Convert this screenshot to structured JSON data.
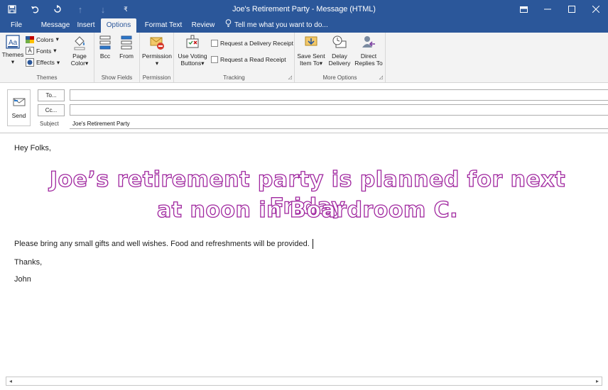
{
  "window": {
    "title": "Joe's Retirement Party - Message (HTML)",
    "accent": "#2b579a"
  },
  "quick_access": {
    "save_icon": "save-icon",
    "undo_icon": "undo-icon",
    "redo_icon": "redo-icon",
    "up_icon": "up-arrow-icon",
    "down_icon": "down-arrow-icon",
    "customize_icon": "customize-icon"
  },
  "tabs": [
    {
      "label": "File"
    },
    {
      "label": "Message"
    },
    {
      "label": "Insert"
    },
    {
      "label": "Options"
    },
    {
      "label": "Format Text"
    },
    {
      "label": "Review"
    }
  ],
  "tell_me": {
    "label": "Tell me what you want to do..."
  },
  "ribbon": {
    "themes_group": {
      "themes": "Themes",
      "colors": "Colors",
      "fonts": "Fonts",
      "effects": "Effects",
      "page_color_1": "Page",
      "page_color_2": "Color",
      "label": "Themes"
    },
    "show_fields": {
      "bcc": "Bcc",
      "from": "From",
      "label": "Show Fields"
    },
    "permission": {
      "button": "Permission",
      "label": "Permission"
    },
    "tracking": {
      "voting_1": "Use Voting",
      "voting_2": "Buttons",
      "delivery": "Request a Delivery Receipt",
      "read": "Request a Read Receipt",
      "label": "Tracking"
    },
    "more_options": {
      "save_sent_1": "Save Sent",
      "save_sent_2": "Item To",
      "delay_1": "Delay",
      "delay_2": "Delivery",
      "direct_1": "Direct",
      "direct_2": "Replies To",
      "label": "More Options"
    }
  },
  "compose": {
    "send": "Send",
    "to_button": "To...",
    "cc_button": "Cc...",
    "subject_label": "Subject",
    "to_value": "",
    "cc_value": "",
    "subject_value": "Joe's Retirement Party"
  },
  "body": {
    "greeting": "Hey Folks,",
    "headline_1": "Joe’s retirement party is planned for next Friday",
    "headline_2": "at noon in Boardroom C.",
    "paragraph": "Please bring any small gifts and well wishes. Food and refreshments will be provided.",
    "closing": "Thanks,",
    "signature": "John",
    "headline_color": "#a0279f"
  }
}
